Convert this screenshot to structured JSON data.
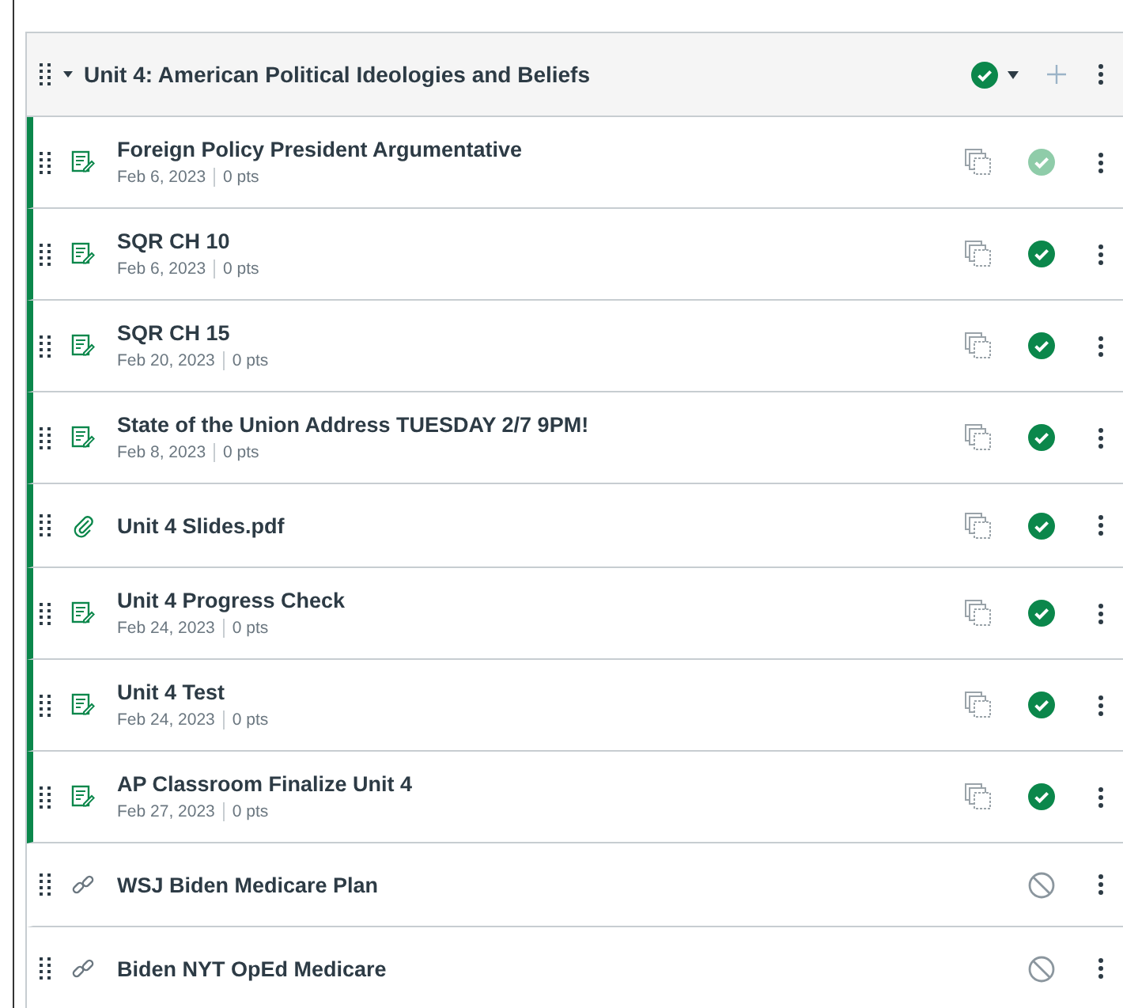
{
  "module": {
    "title": "Unit 4: American Political Ideologies and Beliefs",
    "expanded": true,
    "published": true
  },
  "items": [
    {
      "kind": "assignment",
      "title": "Foreign Policy President Argumentative",
      "date": "Feb 6, 2023",
      "points": "0 pts",
      "published": true,
      "faded": true
    },
    {
      "kind": "assignment",
      "title": "SQR CH 10",
      "date": "Feb 6, 2023",
      "points": "0 pts",
      "published": true,
      "faded": false
    },
    {
      "kind": "assignment",
      "title": "SQR CH 15",
      "date": "Feb 20, 2023",
      "points": "0 pts",
      "published": true,
      "faded": false
    },
    {
      "kind": "assignment",
      "title": "State of the Union Address TUESDAY 2/7 9PM!",
      "date": "Feb 8, 2023",
      "points": "0 pts",
      "published": true,
      "faded": false
    },
    {
      "kind": "file",
      "title": "Unit 4 Slides.pdf",
      "published": true,
      "faded": false
    },
    {
      "kind": "assignment",
      "title": "Unit 4 Progress Check",
      "date": "Feb 24, 2023",
      "points": "0 pts",
      "published": true,
      "faded": false
    },
    {
      "kind": "assignment",
      "title": "Unit 4 Test",
      "date": "Feb 24, 2023",
      "points": "0 pts",
      "published": true,
      "faded": false
    },
    {
      "kind": "assignment",
      "title": "AP Classroom Finalize Unit 4",
      "date": "Feb 27, 2023",
      "points": "0 pts",
      "published": true,
      "faded": false
    },
    {
      "kind": "link",
      "title": "WSJ Biden Medicare Plan",
      "published": false,
      "faded": false
    },
    {
      "kind": "link",
      "title": "Biden NYT OpEd Medicare",
      "published": false,
      "faded": false
    }
  ]
}
